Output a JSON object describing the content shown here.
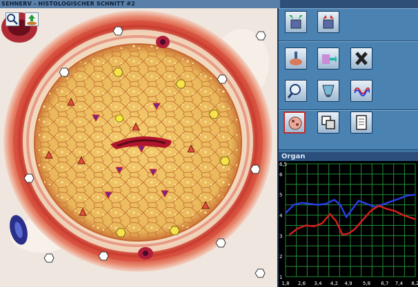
{
  "window": {
    "title": "SEHNERV - HISTOLOGISCHER SCHNITT #2"
  },
  "viewer_tools": [
    {
      "name": "magnifier-tool-button",
      "icon": "magnifier-icon"
    },
    {
      "name": "upload-tool-button",
      "icon": "arrow-up-icon"
    }
  ],
  "panel_buttons": [
    {
      "icon": "container-green-arrows-icon"
    },
    {
      "icon": "container-red-arrows-icon"
    },
    {
      "icon": "lab-flask-icon"
    },
    {
      "icon": "bottle-transfer-icon"
    },
    {
      "icon": "close-x-icon"
    },
    {
      "icon": "magnifier-icon"
    },
    {
      "icon": "cup-icon"
    },
    {
      "icon": "wave-graph-icon"
    },
    {
      "icon": "microorganism-icon"
    },
    {
      "icon": "window-switch-icon"
    },
    {
      "icon": "notes-icon"
    }
  ],
  "organ_chart": {
    "title": "Organ",
    "colors": {
      "background": "#000000",
      "grid": "#1f8f3a",
      "blue": "#2a3de6",
      "red": "#d81e1e"
    }
  },
  "chart_data": {
    "type": "line",
    "title": "Organ",
    "x_ticks": [
      "1,8",
      "2,6",
      "3,4",
      "4,2",
      "4,9",
      "5,8",
      "6,7",
      "7,4",
      "8,2"
    ],
    "y_ticks": [
      "1",
      "2",
      "3",
      "4",
      "5",
      "6",
      "6,5"
    ],
    "ylim": [
      1,
      6.5
    ],
    "xlim": [
      1.8,
      8.2
    ],
    "series": [
      {
        "color": "#2a3de6",
        "x": [
          1.8,
          2.2,
          2.6,
          3.0,
          3.4,
          3.8,
          4.2,
          4.5,
          4.8,
          5.1,
          5.4,
          5.8,
          6.2,
          6.7,
          7.1,
          7.4,
          7.8,
          8.2
        ],
        "y": [
          4.1,
          4.5,
          4.6,
          4.55,
          4.5,
          4.55,
          4.75,
          4.5,
          3.9,
          4.3,
          4.7,
          4.55,
          4.4,
          4.55,
          4.7,
          4.8,
          4.95,
          5.0
        ]
      },
      {
        "color": "#d81e1e",
        "x": [
          2.0,
          2.4,
          2.8,
          3.2,
          3.6,
          4.0,
          4.3,
          4.6,
          4.9,
          5.2,
          5.6,
          6.0,
          6.4,
          6.8,
          7.2,
          7.6,
          8.2
        ],
        "y": [
          3.05,
          3.35,
          3.5,
          3.45,
          3.6,
          4.05,
          3.7,
          3.05,
          3.1,
          3.3,
          3.75,
          4.2,
          4.45,
          4.3,
          4.2,
          4.0,
          3.8
        ]
      }
    ]
  }
}
